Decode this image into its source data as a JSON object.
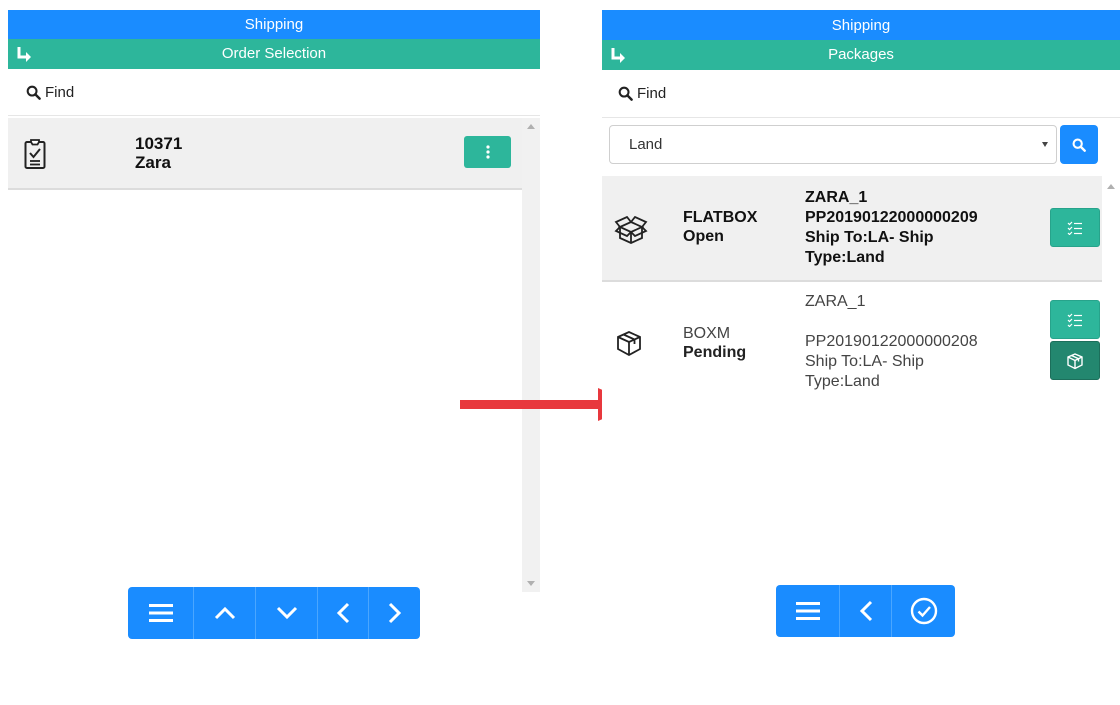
{
  "left": {
    "title": "Shipping",
    "subtitle": "Order Selection",
    "find_label": "Find",
    "order": {
      "number": "10371",
      "customer": "Zara"
    },
    "toolbar": [
      "menu-icon",
      "chevron-up-icon",
      "chevron-down-icon",
      "chevron-left-icon",
      "chevron-right-icon"
    ]
  },
  "right": {
    "title": "Shipping",
    "subtitle": "Packages",
    "find_label": "Find",
    "filter": {
      "value": "Land"
    },
    "packages": [
      {
        "type": "FLATBOX",
        "status": "Open",
        "name": "ZARA_1",
        "id": "PP20190122000000209",
        "ship_to": "Ship To:LA- Ship",
        "ship_type": "Type:Land"
      },
      {
        "type": "BOXM",
        "status": "Pending",
        "name": "ZARA_1",
        "id": "PP20190122000000208",
        "ship_to": "Ship To:LA- Ship",
        "ship_type": "Type:Land"
      }
    ],
    "toolbar": [
      "menu-icon",
      "chevron-left-icon",
      "check-circle-icon"
    ]
  },
  "colors": {
    "header_blue": "#1a8cff",
    "accent_green": "#2db69b",
    "dark_green": "#23876f",
    "arrow_red": "#e8383d"
  }
}
